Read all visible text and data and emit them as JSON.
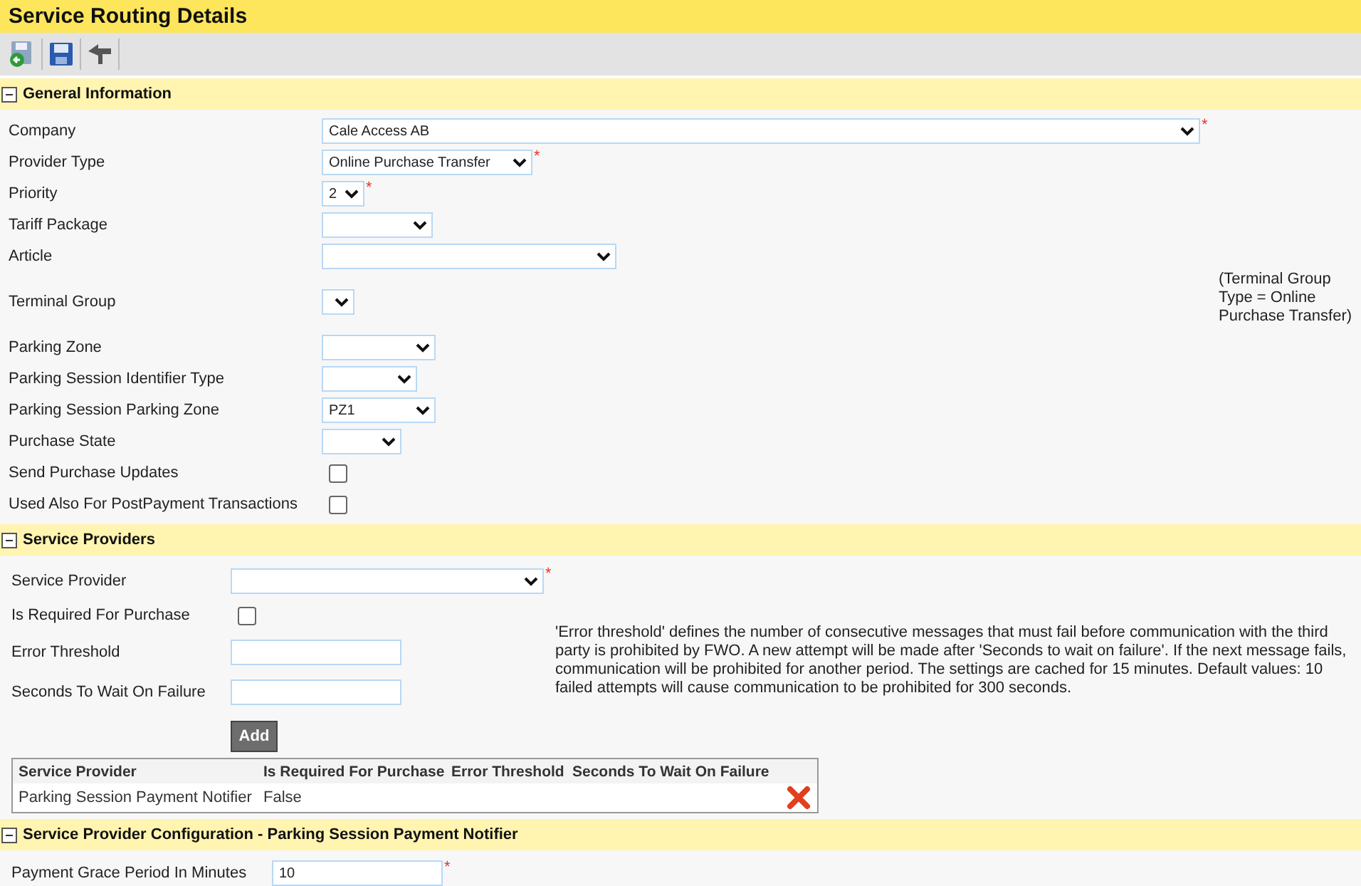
{
  "window": {
    "title": "Service Routing Details"
  },
  "toolbar": [
    {
      "kind": "save-back"
    },
    {
      "kind": "save"
    },
    {
      "kind": "back"
    }
  ],
  "general": {
    "title": "General Information",
    "expanded": true,
    "fields": [
      {
        "label": "Company",
        "kind": "select",
        "value": "Cale Access AB",
        "required_mark": "*"
      },
      {
        "label": "Provider Type",
        "kind": "select",
        "value": "Online Purchase Transfer",
        "required_mark": "*"
      },
      {
        "label": "Priority",
        "kind": "select",
        "value": "2",
        "required_mark": "*"
      },
      {
        "label": "Tariff Package",
        "kind": "select"
      },
      {
        "label": "Article",
        "kind": "select"
      },
      {
        "label": "Terminal Group",
        "kind": "select",
        "note": "(Terminal Group Type = Online Purchase Transfer)"
      },
      {
        "label": "Parking Zone",
        "kind": "select"
      },
      {
        "label": "Parking Session Identifier Type",
        "kind": "select"
      },
      {
        "label": "Parking Session Parking Zone",
        "kind": "select",
        "value": "PZ1"
      },
      {
        "label": "Purchase State",
        "kind": "select"
      },
      {
        "label": "Send Purchase Updates",
        "kind": "checkbox",
        "checked": false
      },
      {
        "label": "Used Also For PostPayment Transactions",
        "kind": "checkbox",
        "checked": false
      }
    ]
  },
  "providers": {
    "title": "Service Providers",
    "expanded": true,
    "fields": [
      {
        "label": "Service Provider",
        "kind": "select",
        "required_mark": "*"
      },
      {
        "label": "Is Required For Purchase",
        "kind": "checkbox",
        "checked": false
      },
      {
        "label": "Error Threshold",
        "kind": "input"
      },
      {
        "label": "Seconds To Wait On Failure",
        "kind": "input"
      }
    ],
    "note": "'Error threshold' defines the number of consecutive messages that must fail before communication with the third party is prohibited by FWO. A new attempt will be made after 'Seconds to wait on failure'. If the next message fails, communication will be prohibited for another period. The settings are cached for 15 minutes. Default values: 10 failed attempts will cause communication to be prohibited for 300 seconds.",
    "add_button": "Add",
    "table": {
      "columns": [
        "Service Provider",
        "Is Required For Purchase",
        "Error Threshold",
        "Seconds To Wait On Failure"
      ],
      "rows": [
        {
          "cells": [
            "Parking Session Payment Notifier",
            "False",
            "",
            ""
          ]
        }
      ]
    }
  },
  "config": {
    "title": "Service Provider Configuration - Parking Session Payment Notifier",
    "expanded": true,
    "fields": [
      {
        "label": "Payment Grace Period In Minutes",
        "kind": "input",
        "value": "10",
        "required_mark": "*"
      }
    ]
  }
}
